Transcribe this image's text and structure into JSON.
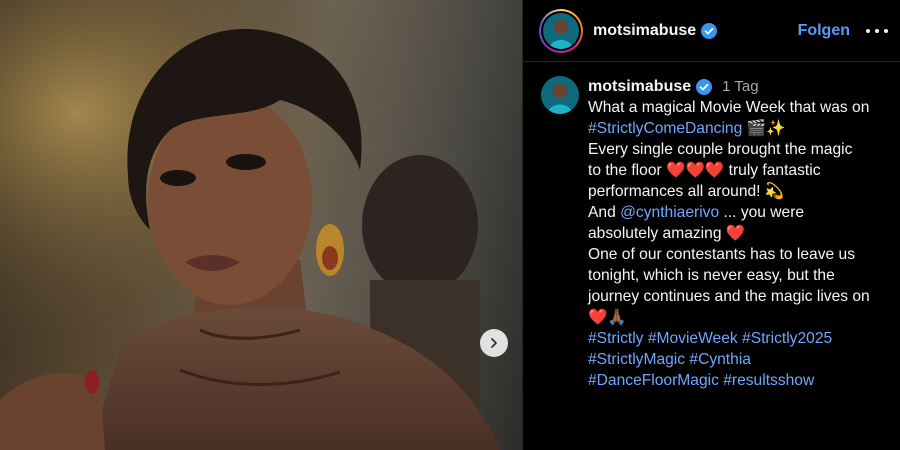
{
  "post": {
    "author": "motsimabuse",
    "follow_label": "Folgen",
    "time_ago": "1 Tag"
  },
  "caption": {
    "l1": "What a magical Movie Week that was on",
    "l2_tag": "#StrictlyComeDancing",
    "l2_emoji": "🎬✨",
    "l3": "Every single couple brought the magic",
    "l4_a": "to the floor",
    "l4_hearts": "❤️❤️❤️",
    "l4_b": "truly fantastic",
    "l5": "performances all around!",
    "l5_emoji": "💫",
    "l6_a": "And",
    "l6_mention": "@cynthiaerivo",
    "l6_b": "... you were",
    "l7": "absolutely amazing",
    "l7_emoji": "❤️",
    "l8": "One of our contestants has to leave us",
    "l9": "tonight, which is never easy, but the",
    "l10": "journey continues and the magic lives on",
    "l11_emoji": "❤️🙏🏾",
    "hashtags": [
      "#Strictly",
      "#MovieWeek",
      "#Strictly2025",
      "#StrictlyMagic",
      "#Cynthia",
      "#DanceFloorMagic",
      "#resultsshow"
    ]
  },
  "colors": {
    "link": "#6ea8fe",
    "follow": "#5b9bf5",
    "verified": "#3897f0"
  },
  "icons": {
    "verified": "verified-badge-icon",
    "next": "chevron-right-icon",
    "more": "more-horizontal-icon"
  }
}
